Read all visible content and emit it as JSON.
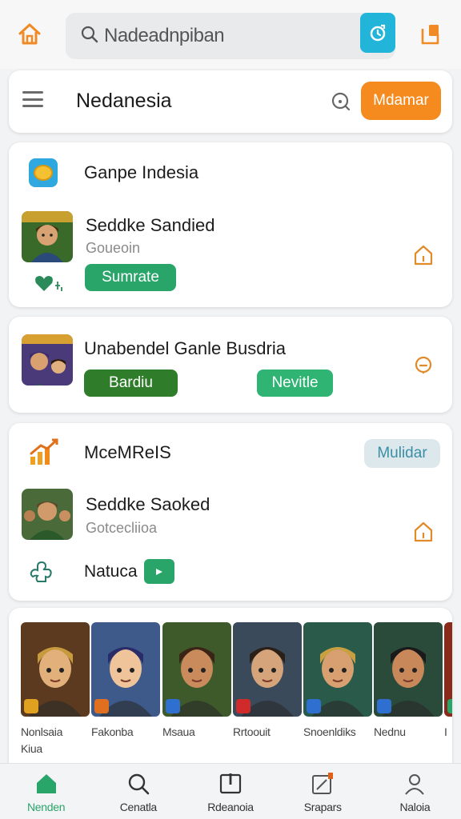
{
  "header": {
    "search_placeholder": "Nadeadnpiban"
  },
  "card1": {
    "title": "Nedanesia",
    "action_label": "Mdamar"
  },
  "card2": {
    "section_title": "Ganpe Indesia",
    "item_title": "Seddke Sandied",
    "item_subtitle": "Goueoin",
    "button_label": "Sumrate"
  },
  "card3": {
    "item_title": "Unabendel Ganle Busdria",
    "button1_label": "Bardiu",
    "button2_label": "Nevitle"
  },
  "card4": {
    "section_title": "MceMReIS",
    "chip_label": "Mulidar",
    "item_title": "Seddke Saoked",
    "item_subtitle": "Gotcecliioa",
    "extra_label": "Natuca"
  },
  "strip": {
    "tiles": [
      {
        "name": "Nonlsaia\nKiua",
        "skin": "#e2b07a",
        "hair": "#c79a3c",
        "bg": "#5b3a1f",
        "badge": "#e0a020"
      },
      {
        "name": "Fakonba",
        "skin": "#f0c49a",
        "hair": "#2a2c6a",
        "bg": "#3d5a8a",
        "badge": "#e07020"
      },
      {
        "name": "Msaua",
        "skin": "#c98a5c",
        "hair": "#3a2416",
        "bg": "#3f5a2a",
        "badge": "#2f6fd0"
      },
      {
        "name": "Rrtoouit",
        "skin": "#d6a47a",
        "hair": "#2a2018",
        "bg": "#3a4a5a",
        "badge": "#d02a2a"
      },
      {
        "name": "Snoenldiks",
        "skin": "#d8a070",
        "hair": "#c8a040",
        "bg": "#2a5a4a",
        "badge": "#2f6fd0"
      },
      {
        "name": "Nednu",
        "skin": "#c8885a",
        "hair": "#1a1a1a",
        "bg": "#2a4a3a",
        "badge": "#2f6fd0"
      },
      {
        "name": "I",
        "skin": "#d09060",
        "hair": "#2a1a0a",
        "bg": "#8a2a1a",
        "badge": "#2aa56a"
      }
    ]
  },
  "nav": {
    "items": [
      {
        "label": "Nenden",
        "icon": "home-icon"
      },
      {
        "label": "Cenatla",
        "icon": "search-icon"
      },
      {
        "label": "Rdeanoia",
        "icon": "grid-icon"
      },
      {
        "label": "Srapars",
        "icon": "edit-icon"
      },
      {
        "label": "Naloia",
        "icon": "profile-icon"
      }
    ]
  },
  "colors": {
    "accent_orange": "#f58a1f",
    "accent_green": "#2aa56a",
    "accent_teal": "#23b4da"
  }
}
